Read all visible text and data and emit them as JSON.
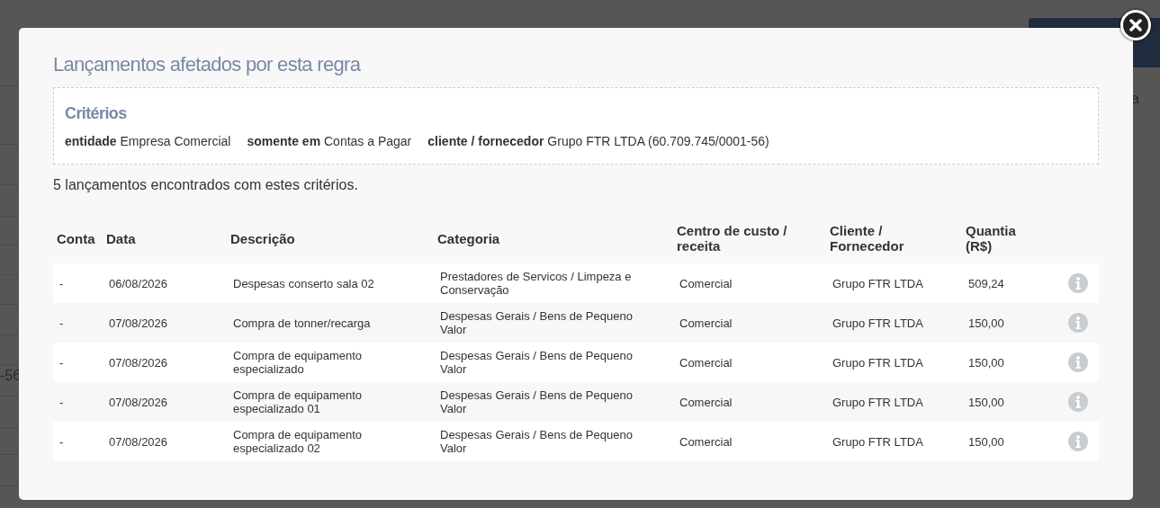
{
  "background": {
    "side_text": "-56",
    "header_text": "a"
  },
  "modal": {
    "title": "Lançamentos afetados por esta regra",
    "criteria": {
      "title": "Critérios",
      "items": [
        {
          "label": "entidade",
          "value": "Empresa Comercial"
        },
        {
          "label": "somente em",
          "value": "Contas a Pagar"
        },
        {
          "label": "cliente / fornecedor",
          "value": "Grupo FTR LTDA (60.709.745/0001-56)"
        }
      ]
    },
    "summary": "5 lançamentos encontrados com estes critérios.",
    "table": {
      "columns": [
        "Conta",
        "Data",
        "Descrição",
        "Categoria",
        "Centro de custo / receita",
        "Cliente / Fornecedor",
        "Quantia (R$)"
      ],
      "rows": [
        {
          "cells": [
            "-",
            "06/08/2026",
            "Despesas conserto sala 02",
            "Prestadores de Servicos / Limpeza e Conservação",
            "Comercial",
            "Grupo FTR LTDA",
            "509,24"
          ]
        },
        {
          "cells": [
            "-",
            "07/08/2026",
            "Compra de tonner/recarga",
            "Despesas Gerais / Bens de Pequeno Valor",
            "Comercial",
            "Grupo FTR LTDA",
            "150,00"
          ]
        },
        {
          "cells": [
            "-",
            "07/08/2026",
            "Compra de equipamento especializado",
            "Despesas Gerais / Bens de Pequeno Valor",
            "Comercial",
            "Grupo FTR LTDA",
            "150,00"
          ]
        },
        {
          "cells": [
            "-",
            "07/08/2026",
            "Compra de equipamento especializado 01",
            "Despesas Gerais / Bens de Pequeno Valor",
            "Comercial",
            "Grupo FTR LTDA",
            "150,00"
          ]
        },
        {
          "cells": [
            "-",
            "07/08/2026",
            "Compra de equipamento especializado 02",
            "Despesas Gerais / Bens de Pequeno Valor",
            "Comercial",
            "Grupo FTR LTDA",
            "150,00"
          ]
        }
      ]
    }
  }
}
